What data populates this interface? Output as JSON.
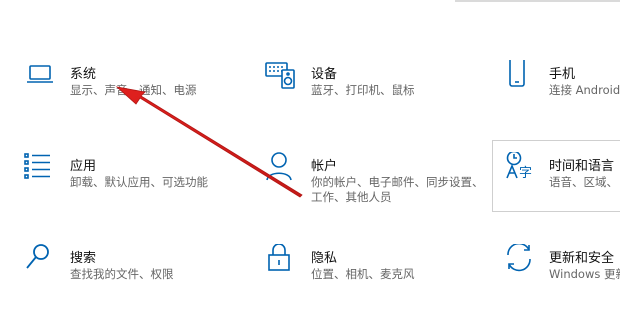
{
  "tiles": {
    "system": {
      "title": "系统",
      "desc": "显示、声音、通知、电源",
      "icon": "laptop-icon"
    },
    "devices": {
      "title": "设备",
      "desc": "蓝牙、打印机、鼠标",
      "icon": "keyboard-speaker-icon"
    },
    "phone": {
      "title": "手机",
      "desc": "连接 Android 设",
      "icon": "phone-icon"
    },
    "apps": {
      "title": "应用",
      "desc": "卸载、默认应用、可选功能",
      "icon": "apps-list-icon"
    },
    "accounts": {
      "title": "帐户",
      "desc_line1": "你的帐户、电子邮件、同步设置、",
      "desc_line2": "工作、其他人员",
      "icon": "person-icon"
    },
    "time": {
      "title": "时间和语言",
      "desc": "语音、区域、日",
      "icon": "time-language-icon"
    },
    "search": {
      "title": "搜索",
      "desc": "查找我的文件、权限",
      "icon": "search-icon"
    },
    "privacy": {
      "title": "隐私",
      "desc": "位置、相机、麦克风",
      "icon": "lock-icon"
    },
    "update": {
      "title": "更新和安全",
      "desc": "Windows 更新",
      "icon": "sync-icon"
    }
  },
  "colors": {
    "accent": "#0063b1",
    "annotation_arrow": "#e0201e"
  }
}
